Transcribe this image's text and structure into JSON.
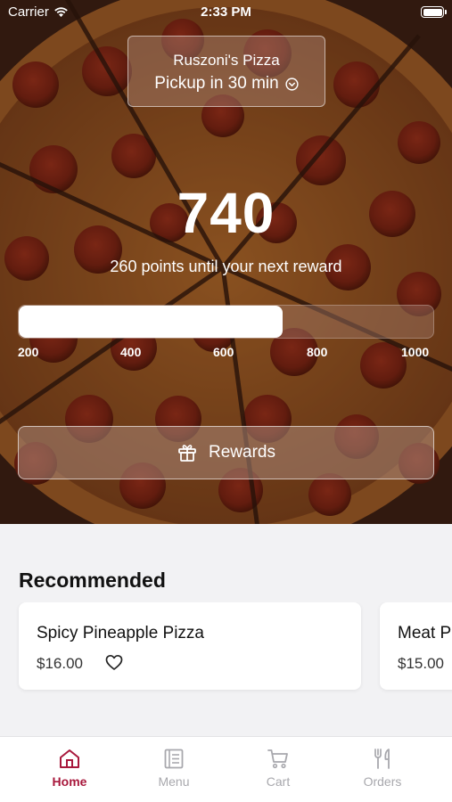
{
  "status_bar": {
    "carrier": "Carrier",
    "time": "2:33 PM"
  },
  "store": {
    "name": "Ruszoni's Pizza",
    "pickup": "Pickup in 30 min"
  },
  "points": {
    "value": "740",
    "subtext": "260 points until your next reward",
    "progress_fraction": 0.636,
    "ticks": [
      "200",
      "400",
      "600",
      "800",
      "1000"
    ]
  },
  "rewards_button": {
    "label": "Rewards",
    "icon": "gift-icon"
  },
  "recommended": {
    "title": "Recommended",
    "items": [
      {
        "name": "Spicy Pineapple Pizza",
        "price": "$16.00"
      },
      {
        "name": "Meat P",
        "price": "$15.00"
      }
    ]
  },
  "tabs": [
    {
      "label": "Home",
      "icon": "home-icon",
      "active": true
    },
    {
      "label": "Menu",
      "icon": "menu-icon",
      "active": false
    },
    {
      "label": "Cart",
      "icon": "cart-icon",
      "active": false
    },
    {
      "label": "Orders",
      "icon": "utensils-icon",
      "active": false
    }
  ],
  "colors": {
    "accent": "#a8183c",
    "inactive_tab": "#a8a8ad"
  }
}
